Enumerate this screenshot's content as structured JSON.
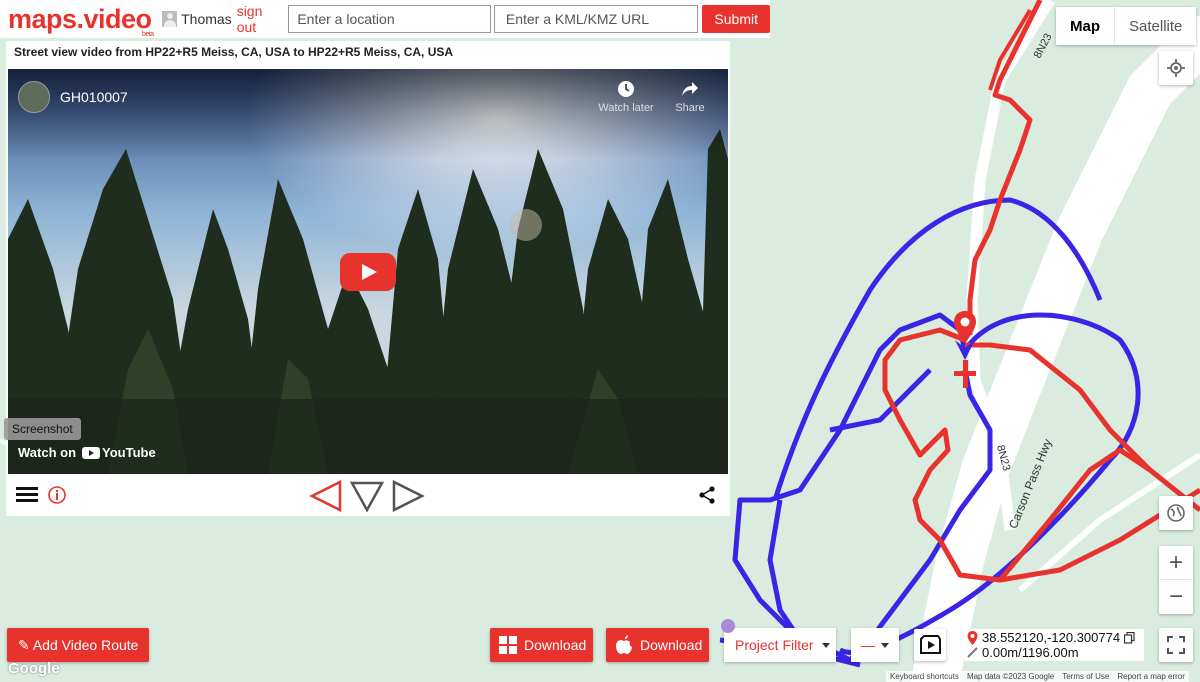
{
  "header": {
    "logo": "maps.video",
    "logo_badge": "beta",
    "username": "Thomas",
    "signout": "sign out",
    "location_placeholder": "Enter a location",
    "kml_placeholder": "Enter a KML/KMZ URL",
    "submit": "Submit"
  },
  "video_panel": {
    "title": "Street view video from HP22+R5 Meiss, CA, USA to HP22+R5 Meiss, CA, USA",
    "video_title": "GH010007",
    "watch_later": "Watch later",
    "share": "Share",
    "screenshot_tooltip": "Screenshot",
    "watch_on": "Watch on",
    "youtube": "YouTube"
  },
  "map": {
    "map_type": [
      "Map",
      "Satellite"
    ],
    "selected_map_type": "Map",
    "road_labels": [
      "8N23",
      "8N23",
      "Carson Pass Hwy"
    ],
    "zoom_in": "+",
    "zoom_out": "−"
  },
  "bottom": {
    "add_route": "✎ Add Video Route",
    "download_windows": "Download",
    "download_mac": "Download",
    "project_filter": "Project Filter",
    "line_style": "—"
  },
  "coords": {
    "latlng": "38.552120,-120.300774",
    "distance": "0.00m/1196.00m"
  },
  "attribution": {
    "google": "Google",
    "shortcuts": "Keyboard shortcuts",
    "map_data": "Map data ©2023 Google",
    "terms": "Terms of Use",
    "report": "Report a map error"
  },
  "colors": {
    "accent": "#e8322d",
    "route_red": "#e8322d",
    "route_blue": "#3a25e6",
    "map_bg": "#d9ecdf"
  }
}
